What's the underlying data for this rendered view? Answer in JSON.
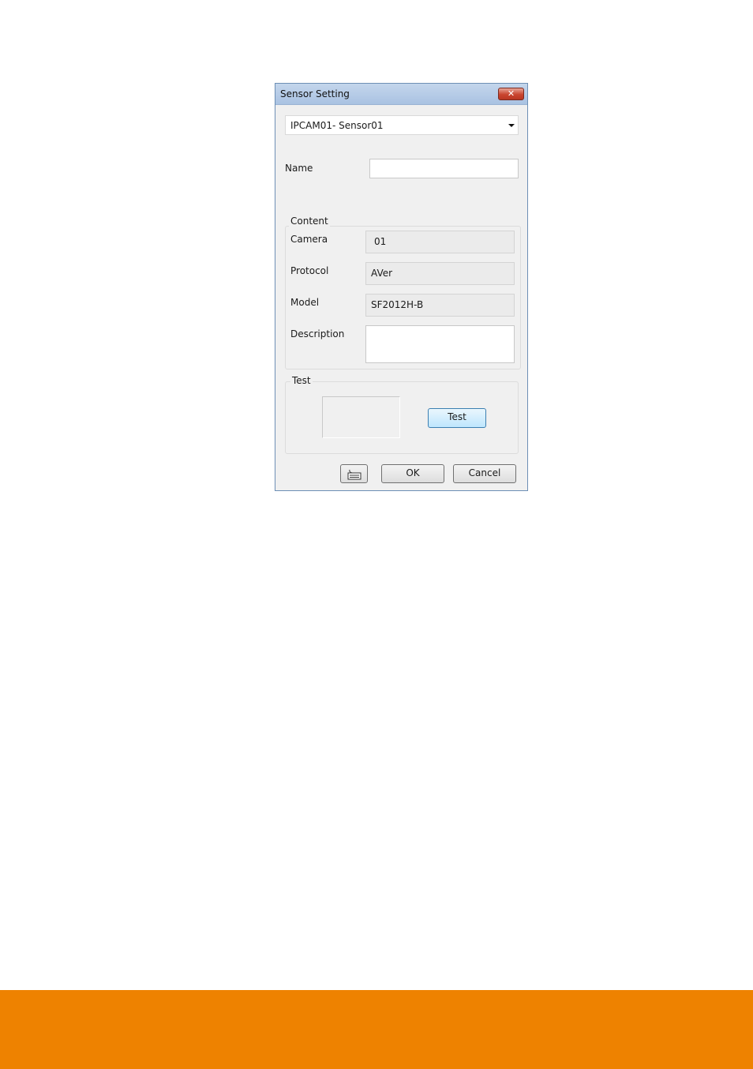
{
  "dialog": {
    "title": "Sensor Setting",
    "close_label": "✕",
    "sensor_select": {
      "value": "IPCAM01- Sensor01"
    },
    "name": {
      "label": "Name",
      "value": ""
    },
    "content": {
      "group_label": "Content",
      "camera": {
        "label": "Camera",
        "value": "01"
      },
      "protocol": {
        "label": "Protocol",
        "value": "AVer"
      },
      "model": {
        "label": "Model",
        "value": "SF2012H-B"
      },
      "description": {
        "label": "Description",
        "value": ""
      }
    },
    "test": {
      "group_label": "Test",
      "button_label": "Test"
    },
    "footer": {
      "keyboard_icon": "keyboard-icon",
      "ok_label": "OK",
      "cancel_label": "Cancel"
    }
  },
  "colors": {
    "footer_bar": "#ee8200",
    "titlebar": "#b7cce8",
    "close_button": "#c9452f"
  }
}
